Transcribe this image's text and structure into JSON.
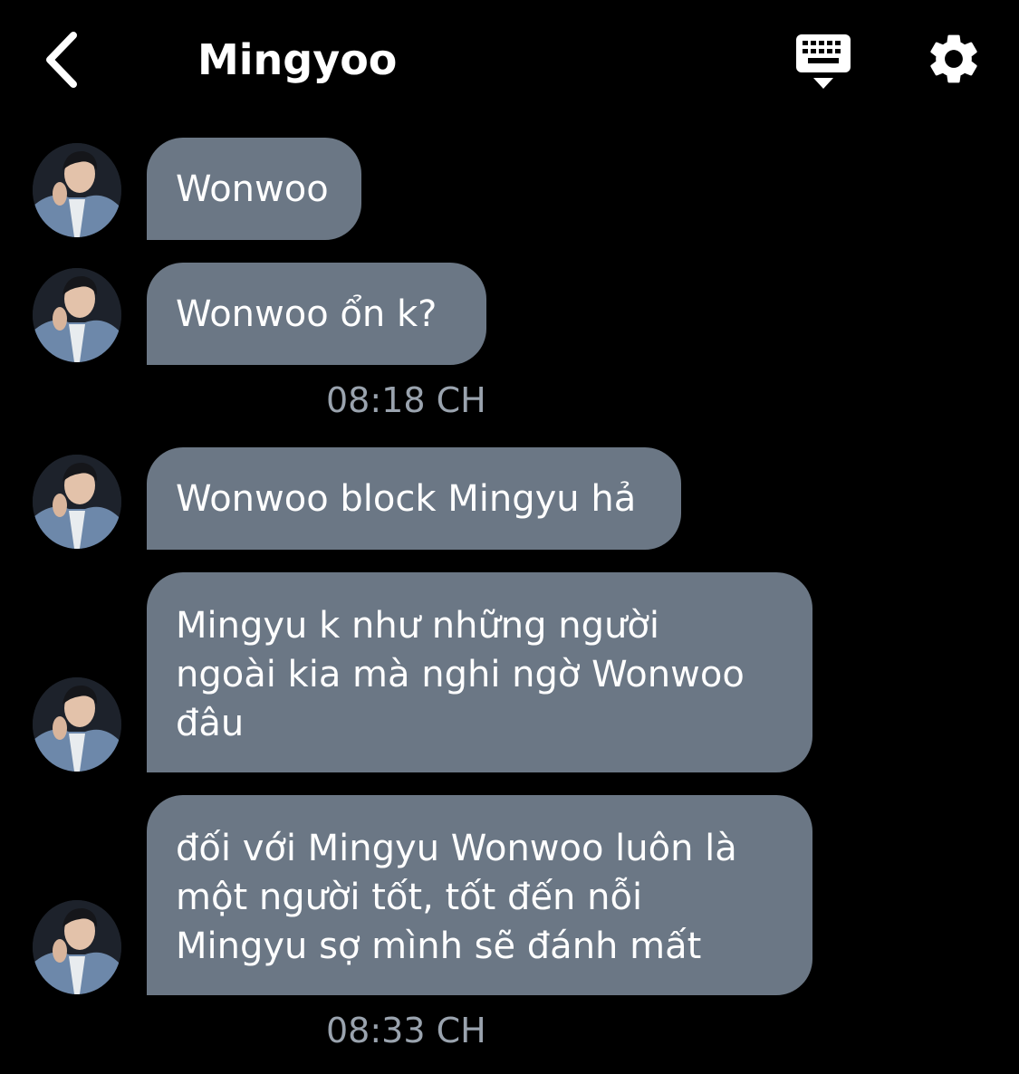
{
  "header": {
    "title": "Mingyoo",
    "back_icon": "chevron-left-icon",
    "keyboard_icon": "keyboard-icon",
    "settings_icon": "gear-icon"
  },
  "colors": {
    "background": "#000000",
    "bubble": "#6b7785",
    "bubble_text": "#ffffff",
    "timestamp": "#9aa3ae"
  },
  "messages": [
    {
      "text": "Wonwoo"
    },
    {
      "text": "Wonwoo ổn k?"
    },
    {
      "text": "Wonwoo block Mingyu hả"
    },
    {
      "lines": [
        "Mingyu k như những người",
        "ngoài kia mà nghi ngờ Wonwoo",
        "đâu"
      ]
    },
    {
      "lines": [
        "đối với Mingyu Wonwoo luôn là",
        "một người tốt, tốt đến nỗi",
        "Mingyu sợ mình sẽ đánh mất"
      ]
    }
  ],
  "timestamps": [
    "08:18 CH",
    "08:33 CH"
  ]
}
